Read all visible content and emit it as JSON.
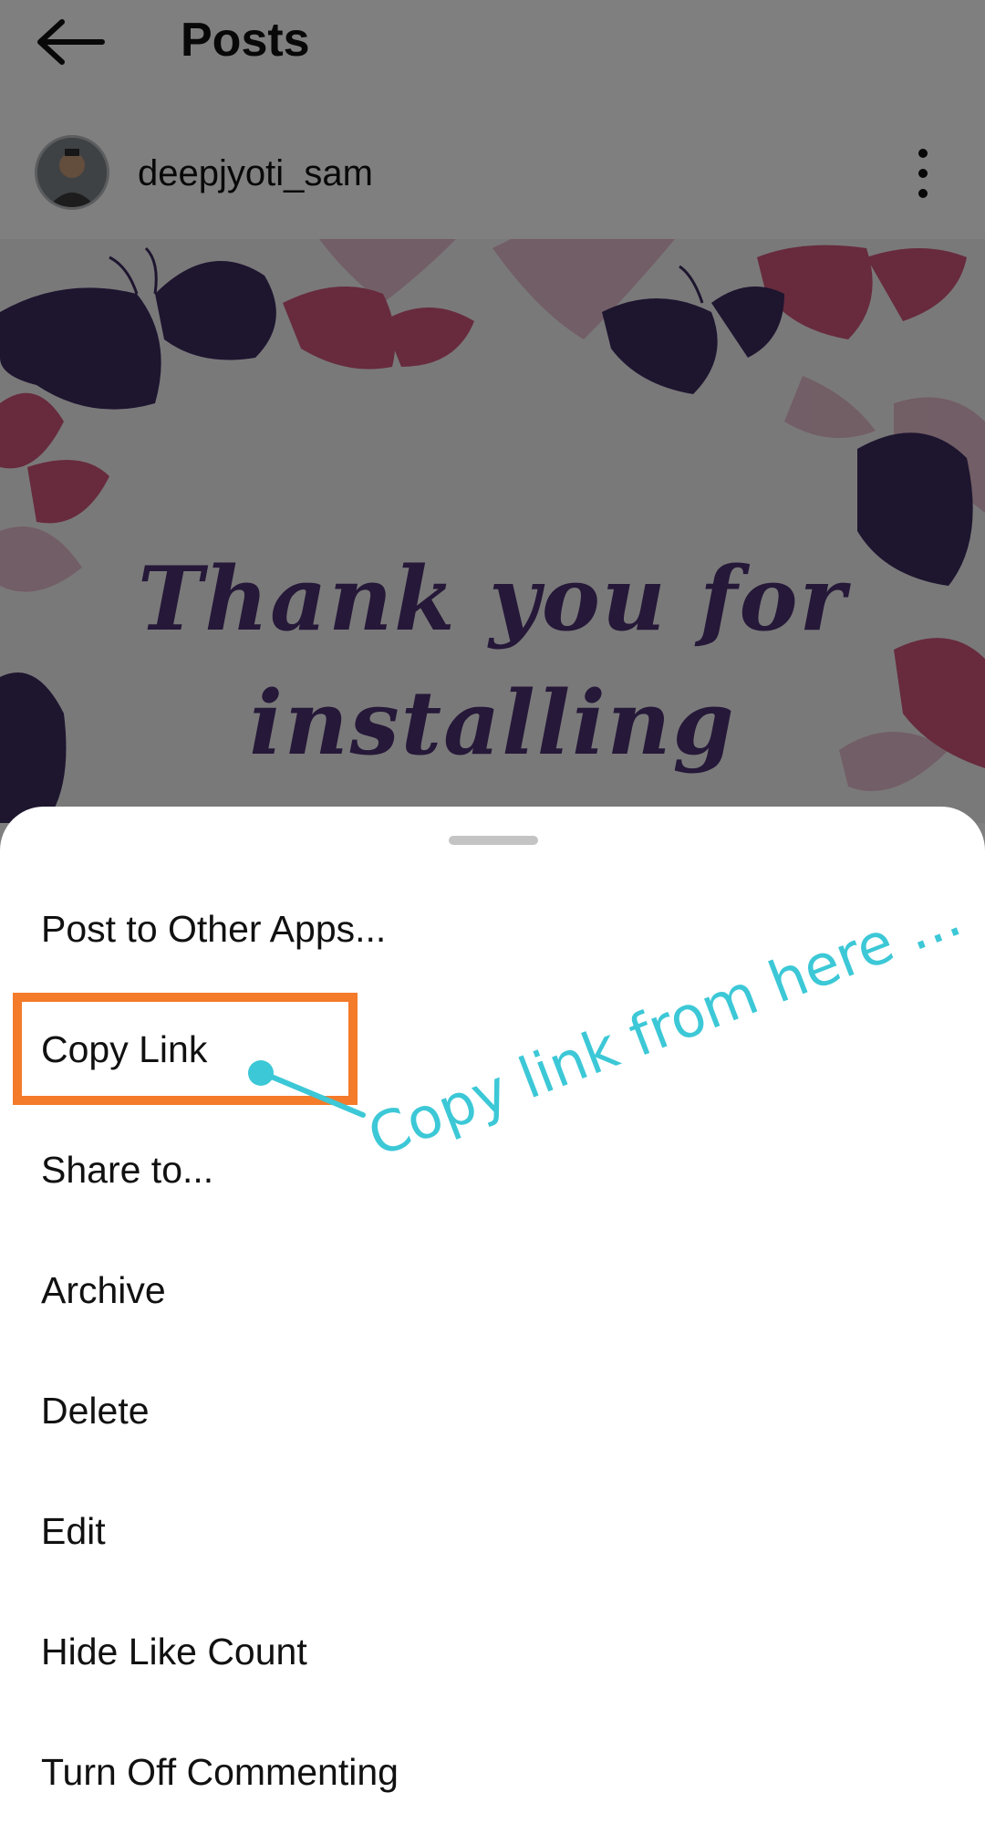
{
  "header": {
    "title": "Posts"
  },
  "post": {
    "username": "deepjyoti_sam",
    "image_text_line1": "Thank you for",
    "image_text_line2": "installing"
  },
  "sheet": {
    "items": [
      {
        "label": "Post to Other Apps..."
      },
      {
        "label": "Copy Link"
      },
      {
        "label": "Share to..."
      },
      {
        "label": "Archive"
      },
      {
        "label": "Delete"
      },
      {
        "label": "Edit"
      },
      {
        "label": "Hide Like Count"
      },
      {
        "label": "Turn Off Commenting"
      }
    ]
  },
  "annotation": {
    "text": "Copy link from here ...",
    "highlight_color": "#f47b2a",
    "text_color": "#3cc8d6"
  },
  "colors": {
    "butterfly_purple": "#3d2a5e",
    "butterfly_pink": "#cc5577",
    "butterfly_light": "#dfaabb",
    "scrim": "rgba(0,0,0,0.5)"
  },
  "icons": {
    "back": "arrow-left-icon",
    "more": "more-vertical-icon",
    "handle": "drag-handle"
  }
}
